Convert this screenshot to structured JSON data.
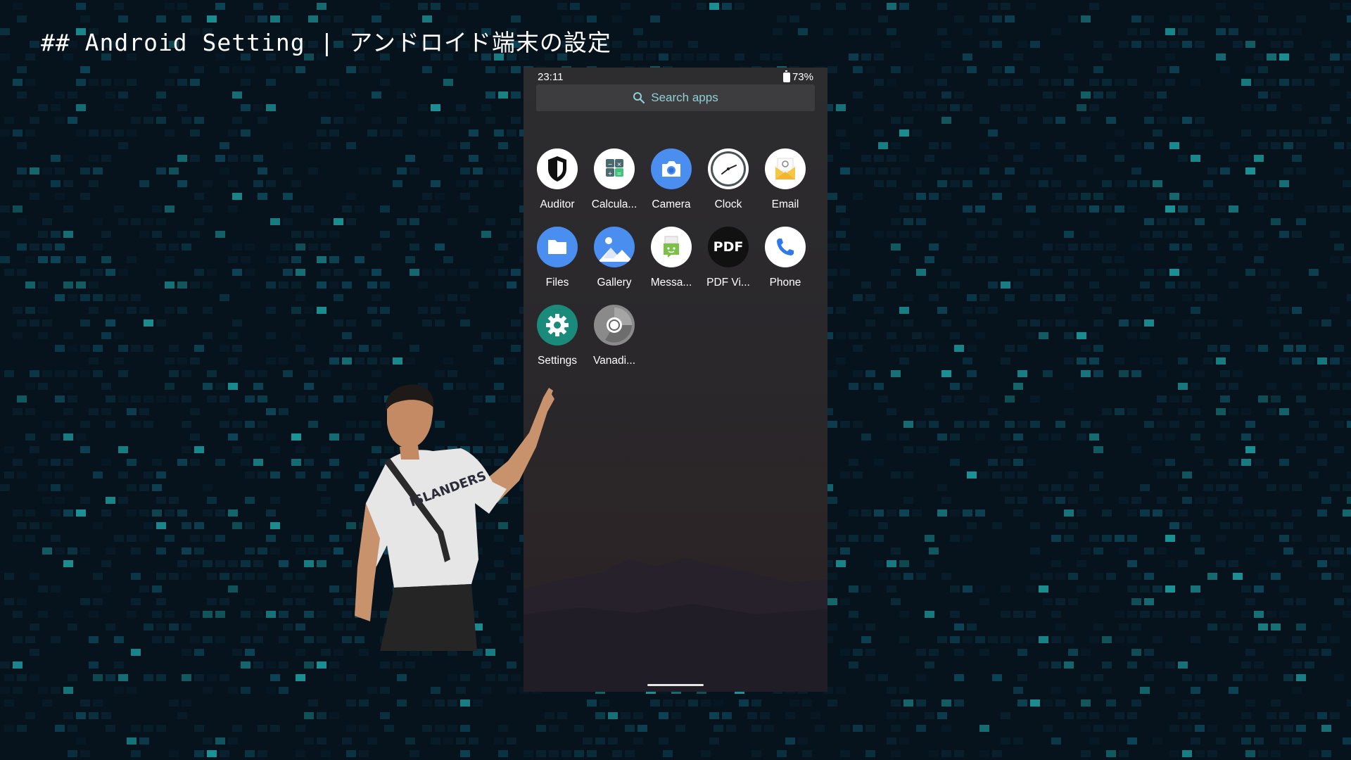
{
  "slide": {
    "title": "## Android Setting | アンドロイド端末の設定"
  },
  "status_bar": {
    "time": "23:11",
    "battery": "73%"
  },
  "search": {
    "label": "Search apps",
    "icon": "search-icon"
  },
  "apps": [
    {
      "label": "Auditor",
      "icon": "shield-icon",
      "color": "#ffffff"
    },
    {
      "label": "Calcula...",
      "icon": "calculator-icon",
      "color": "#ffffff"
    },
    {
      "label": "Camera",
      "icon": "camera-icon",
      "color": "#4a8ef0"
    },
    {
      "label": "Clock",
      "icon": "clock-icon",
      "color": "#ffffff"
    },
    {
      "label": "Email",
      "icon": "envelope-icon",
      "color": "#ffffff"
    },
    {
      "label": "Files",
      "icon": "folder-icon",
      "color": "#4a8ef0"
    },
    {
      "label": "Gallery",
      "icon": "image-icon",
      "color": "#4a8ef0"
    },
    {
      "label": "Messa...",
      "icon": "message-icon",
      "color": "#ffffff"
    },
    {
      "label": "PDF Vi...",
      "icon": "pdf-icon",
      "color": "#111111"
    },
    {
      "label": "Phone",
      "icon": "phone-icon",
      "color": "#ffffff"
    },
    {
      "label": "Settings",
      "icon": "gear-icon",
      "color": "#1a8a7a"
    },
    {
      "label": "Vanadi...",
      "icon": "browser-icon",
      "color": "#8a8a8a"
    }
  ]
}
